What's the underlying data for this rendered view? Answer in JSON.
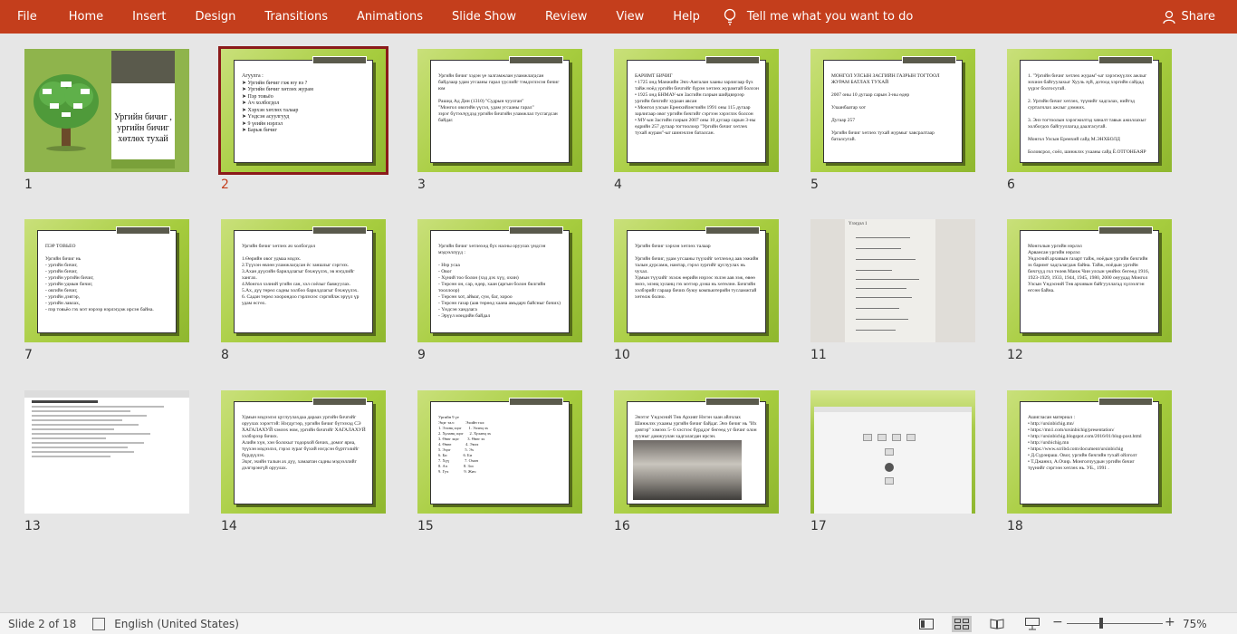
{
  "ribbon": {
    "tabs": [
      "File",
      "Home",
      "Insert",
      "Design",
      "Transitions",
      "Animations",
      "Slide Show",
      "Review",
      "View",
      "Help"
    ],
    "tell_me": "Tell me what you want to do",
    "share": "Share",
    "color": "#c43e1c"
  },
  "slides": [
    {
      "n": "1",
      "title": "Ургийн бичиг , ургийн бичиг хөтлөх тухай"
    },
    {
      "n": "2",
      "text": "Агуулга :\n➤ Ургийн бичиг гэж юу вэ ?\n➤ Ургийн бичиг хөтлөх журам\n➤ Пэр товьёо\n➤ Ач холбогдол\n➤ Хэрхэн хөтлөх талаар\n➤ Үндсэн асуулгууд\n➤ 9 үеийн нэрлэл\n➤ Барьж бичиг"
    },
    {
      "n": "3",
      "text": "Ургийн бичиг хэдэн үе залгамжлан уламжлагдсан байдлаар удам угсааны гарал үүслийг тэмдэглэсэн бичиг юм\n\nРашид Ад Дин (1310) \"Судрын чуулган\"\n\"Монгол овогийн үүсэл, удам угсааны гарал\"\nзэрэг бүтээлүүдэд ургийн бичгийн уламжлал тусгагдсан байдаг."
    },
    {
      "n": "4",
      "text": "БАРИМТ БИЧИГ\n• 1725 онд Манжийн Энх-Амгалан хааны зарлигаар бүх тайж ноёд ургийн бичгийг бүрэн хөтлөх журамтай болсон\n• 1925 онд БНМАУ-ын Засгийн газрын шийдвэрээр ургийн бичгийг хураан авсан\n• Монгол улсын Ерөнхийлөгчийн 1991 оны 115 дугаар зарлигаар овог ургийн бичгийг сэргээн хэрэглэх болсон\n• МУ-ын Засгийн газрын 2007 оны 10 дугаар сарын 3-ны өдрийн 257 дугаар тогтоолоор \"Ургийн бичиг хөтлөх тухай журам\"-ыг шинэчлэн баталсан."
    },
    {
      "n": "5",
      "text": "МОНГОЛ УЛСЫН ЗАСГИЙН ГАЗРЫН ТОГТООЛ\nЖУРАМ БАТЛАХ ТУХАЙ\n\n2007 оны 10 дугаар сарын 3-ны өдөр\n\nУлаанбаатар хот\n\nДугаар 257\n\nУргийн бичиг хөтлөх тухай журмыг хавсралтаар баталсугай."
    },
    {
      "n": "6",
      "text": "1. \"Ургийн бичиг хөтлөх журам\"-ыг хэрэгжүүлэх ажлыг зохион байгуулахыг Хууль зүй, дотоод хэргийн сайдад үүрэг болгосугай.\n\n2. Ургийн бичиг хөтлөх, түүнийг хадгалах, нийтэд сурталчлах ажлыг дэмжих.\n\n3. Энэ тогтоолын хэрэгжилтэд хяналт тавьж ажиллахыг холбогдох байгууллагад даалгасугай.\n\nМонгол Улсын Ерөнхий сайд М.ЭНХБОЛД\n\nБоловсрол, соёл, шинжлэх ухааны сайд Ё.ОТГОНБАЯР"
    },
    {
      "n": "7",
      "text": "ПЭР ТОВЬЁО\n\n  Ургийн бичиг нь\n- ургийн бичиг,\n- ургийн бичиг,\n- ургийн ургийн бичиг,\n- ургийн удмын бичиг,\n- овгийн бичиг,\n- ургийн дэвтэр,\n- ургийн лавлах,\n- пэр товьёо гэх мэт нэрээр нэрлэгдэж ирсэн байна."
    },
    {
      "n": "8",
      "text": "Ургийн бичиг хөтлөх ач холбогдол\n\n1.Өөрийн овог удмаа мэдэх.\n2.Түүхэн өвлөн уламжлагдсан ёс заншлыг сэргээх.\n3.Ахан дүүсийн барилдлагыг бэхжүүлэх, эв нэгдлийг хангах.\n4.Монгол хэлний үгийн сан, хэл соёлыг баяжуулах.\n5.Ах, дүү төрөл садны холбоо барилдлагыг бэхжүүлэх.\n6. Садан төрөл хоорондоо гэрлэхээс сэргийлж эрүүл үр удам өсгөх."
    },
    {
      "n": "9",
      "text": "Ургийн бичиг хөтлөхөд бүх насны оруулах үндсэн мэдээллүүд :\n\n- Нэр усаа\n- Овог\n- Хүний тоо болон (хэд дэх хүү, охин)\n- Төрсөн он, сар, өдөр, хаан (аргын болон билгийн тооллоор)\n- Төрсөн хот, аймаг, сум, баг, хороо\n- Төрсөн газар (аав төрөөд хаана амьдарч байсныг бичих)\n- Үндсэн хандлага\n- Эрүүл мэндийн байдал"
    },
    {
      "n": "10",
      "text": "Ургийн бичиг хэрхэн хөтлөх талаар\n\nУргийн бичиг, удам угсааны түүхийг хөтлөхөд аав ээжийн талын дурсамж, намтар, гэрэл зургийг цуглуулах нь чухал.\nУдмын түүхийг эхэлж өөрийн нэрээс эхлэн аав ээж, өвөө эмээ, элэнц хуланц гэх мэтээр дээш нь хөтөлнө. Бичгийн хэлбэрийг гараар бичих буюу компьютерийн тусламжтай хөтөлж болно."
    },
    {
      "n": "11",
      "text": "Үзэгдэл 1"
    },
    {
      "n": "12",
      "text": "Монголын ургийн нэрлэл\nАрвансан ургийн нэрлэл\nУндэсний архивын газарт тайж, ноёдын ургийн бичгийн эх баримт хадгалагдаж байна. Тайж, ноёдын ургийн бичгүүд гол төлөв Манж Чин улсын үеийнх бөгөөд 1916, 1923-1929, 1933, 1944, 1945, 1980, 2000 онуудад Монгол Улсын Үндэсний Төв архивын байгууллагад хүлээлгэн өгсөн байна."
    },
    {
      "n": "13",
      "text": ""
    },
    {
      "n": "14",
      "text": "Удмын мэдээлэл цуглуулахдаа дараах ургийн бичгийг оруулах хэрэгтэй: Нэгдүгээр, ургийн бичиг бүтээхэд СЭ ХАГАЛАХУЙ хэмээх ном, ургийн бичгийг ХАГАЛАХУЙ хэлбэрээр бичих.\nАлийн хүн, хэн болохыг тодорхой бичих, домог яриа, түүхэн мэдээлэл, гэрэл зураг бүхий нэгдсэн бүртгэлийг бүрдүүлэх.\nЭцэг, эхийн талын ах дүү, хамаатан садны мэдээллийг дэлгэрэнгүй оруулах."
    },
    {
      "n": "15",
      "text": "Ургийн 9 үе\nЭцэг тал:           Эхийн тал:\n1. Элэнц эцэг       1. Элэнц эх\n2. Хуланц эцэг      2. Хуланц эх\n3. Өвөг эцэг        3. Өвөг эх\n4. Өвөө              4. Эмээ\n5. Эцэг              5. Эх\n6. Би                6. Би\n7. Хүү               7. Охин\n8. Ач                8. Зээ\n9. Гуч               9. Жич"
    },
    {
      "n": "16",
      "text": "Энэтэг Үндэсний Төв Архивт Нэгэн хаан айлчлах Шинжлэх ухааны ургийн бичиг байдаг. Энэ бичиг нь \"Их дэвтэр\" хэмээх 5- 6 хэсгээс бүрддэг бөгөөд уг бичиг олон зууныг дамжуулан хадгалагдан ирсэн."
    },
    {
      "n": "17",
      "text": ""
    },
    {
      "n": "18",
      "text": "Ашигласан материал :\n• http://ursinbichig.mn/\n• https://mn1.com/ursinbichig/presentation/\n• http://ursinbichig.blogspot.com/2016/01/blog-post.html\n• http://ursbichig.mn\n• https://www.scribd.com/document/ursinbichig\n• Д.Сүрэнраш. Овог, ургийн бичгийн тухай ойлголт\n• Т.Джаннл, А.Очир. Монголчуудын ургийн бичиг түүнийг сэргээн хөтлөх нь. УБ., 1991 ."
    }
  ],
  "status": {
    "slide_counter": "Slide 2 of 18",
    "language": "English (United States)",
    "zoom": "75%"
  }
}
